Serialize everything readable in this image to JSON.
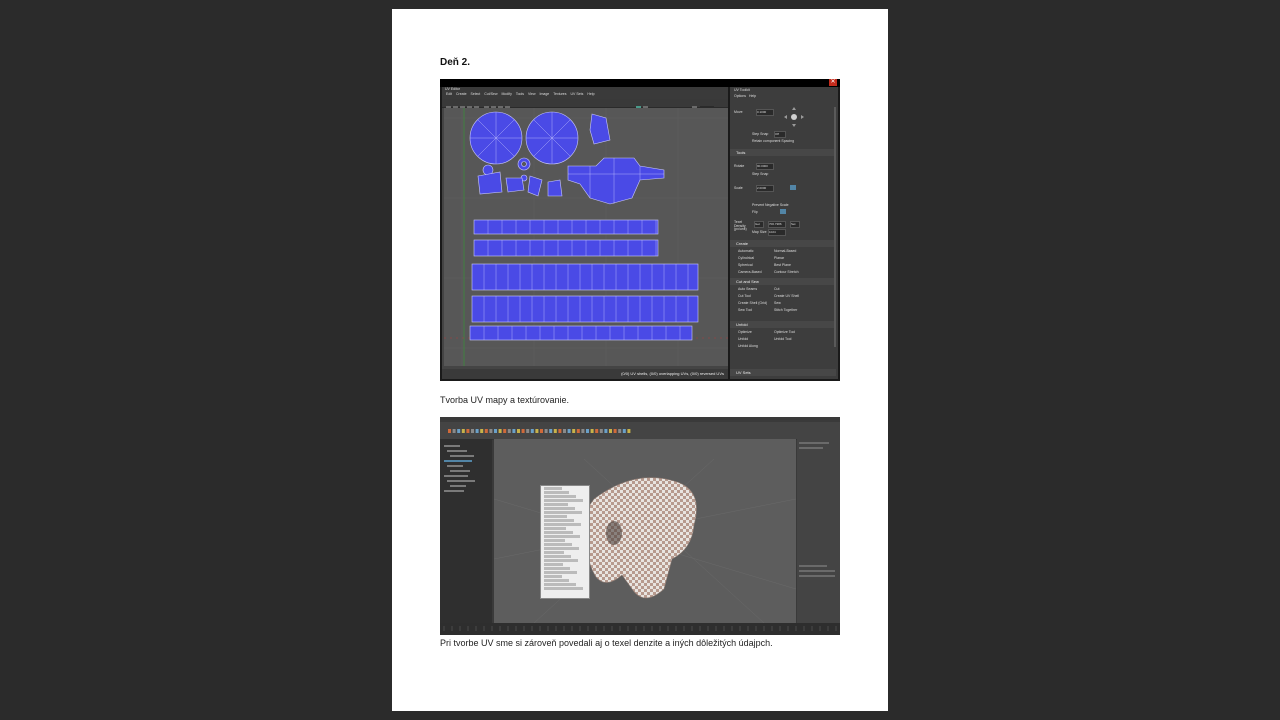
{
  "document": {
    "heading": "Deň 2.",
    "caption_1": "Tvorba UV mapy a textúrovanie.",
    "caption_2": "Pri tvorbe UV sme si zároveň povedali aj o texel denzite a iných dôležitých údajpch."
  },
  "uv_editor": {
    "window_title": "UV Editor",
    "menu": [
      "Edit",
      "Create",
      "Select",
      "Cut/Sew",
      "Modify",
      "Tools",
      "View",
      "Image",
      "Textures",
      "UV Sets",
      "Help"
    ],
    "status_text": "(0/0) UV shells, (0/0) overlapping UVs, (0/0) reversed UVs",
    "toolkit_title": "UV Toolkit",
    "toolkit_menu": [
      "Options",
      "Help"
    ],
    "toolkit": {
      "move_label": "Move",
      "move_value": "0.1000",
      "step_snap_label": "Step Snap",
      "step_snap_off": "Off",
      "retain_spacing": "Retain component Spacing",
      "scale_section": "Tools",
      "rotate_label": "Rotate",
      "rotate_value": "90.0000",
      "scale_label": "Scale",
      "scale_value": "2.0000",
      "prevent_negative": "Prevent Negative Scale",
      "flip_label": "Flip",
      "texel_label": "Texel Density (px/unit)",
      "texel_get": "Get",
      "texel_value": "700.7386",
      "texel_set": "Set",
      "map_size_label": "Map Size",
      "map_size_value": "1024",
      "create_section": "Create",
      "create_items": [
        "Automatic",
        "Normal-Based",
        "Cylindrical",
        "Planar",
        "Spherical",
        "Best Plane",
        "Camera-Based",
        "Contour Stretch"
      ],
      "cut_sew_section": "Cut and Sew",
      "cut_sew_items": [
        "Auto Seams",
        "Cut",
        "Cut Tool",
        "Create UV Shell",
        "Create Shell (Grid)",
        "Sew",
        "Sew Tool",
        "Stitch Together"
      ],
      "unfold_section": "Unfold",
      "unfold_items": [
        "Optimize",
        "Optimize Tool",
        "Unfold",
        "Unfold Tool",
        "Unfold Along"
      ],
      "uv_sets_section": "UV Sets"
    }
  },
  "colors": {
    "uv_shell_fill": "#4a4ae6",
    "uv_shell_line": "#c8c8ff",
    "uv_grid_bg": "#575757",
    "page_bg": "#2b2b2b",
    "maya_viewport": "#5d5d5d"
  }
}
